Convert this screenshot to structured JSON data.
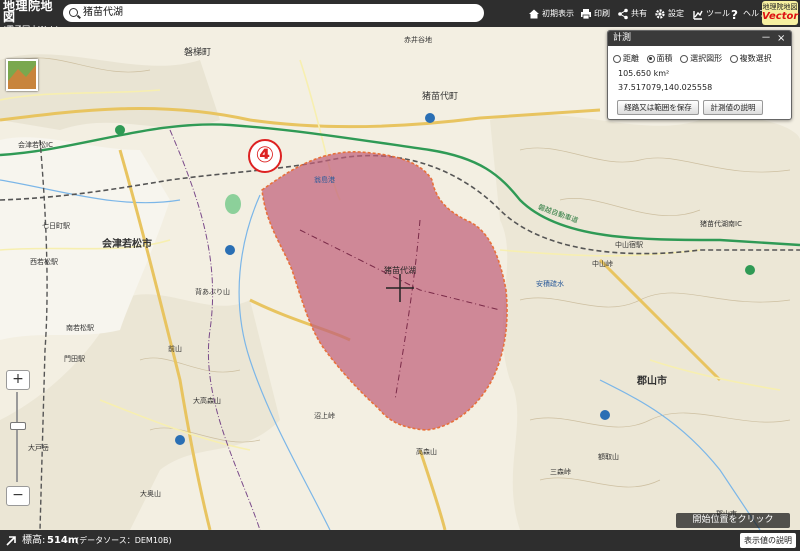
{
  "header": {
    "logo_title": "地理院地図",
    "logo_subtitle": "(電子国土Web)",
    "search_value": "猪苗代湖",
    "initial_view_label": "初期表示",
    "print_label": "印刷",
    "share_label": "共有",
    "settings_label": "設定",
    "tools_label": "ツール",
    "help_label": "ヘルプ",
    "vector_badge_top": "地理院地図",
    "vector_badge_main": "Vector"
  },
  "measure_panel": {
    "title": "計測",
    "minimize": "－",
    "close": "×",
    "options": [
      "距離",
      "面積",
      "選択図形",
      "複数選択"
    ],
    "selected_option": "面積",
    "area_value": "105.650 km²",
    "coordinates": "37.517079,140.025558",
    "save_button": "経路又は範囲を保存",
    "explain_button": "計測値の説明"
  },
  "map": {
    "marker_number": "④",
    "colors": {
      "lake_fill": "#c0607a",
      "lake_edge": "#e8703a",
      "road_green": "#2f9a55",
      "road_major": "#f2e6a0",
      "road_national": "#e0a040"
    },
    "labels": [
      {
        "text": "磐梯町"
      },
      {
        "text": "猪苗代町"
      },
      {
        "text": "猪苗代湖"
      },
      {
        "text": "会津若松市"
      },
      {
        "text": "郡山市"
      },
      {
        "text": "磐越自動車道"
      },
      {
        "text": "翁島港"
      },
      {
        "text": "会津若松IC"
      },
      {
        "text": "七日町駅"
      },
      {
        "text": "西若松駅"
      },
      {
        "text": "南若松駅"
      },
      {
        "text": "門田駅"
      },
      {
        "text": "背あぶり山"
      },
      {
        "text": "大高森山"
      },
      {
        "text": "額取山"
      },
      {
        "text": "猪苗代湖南IC"
      },
      {
        "text": "中山宿駅"
      },
      {
        "text": "高森山"
      },
      {
        "text": "前山"
      },
      {
        "text": "赤井谷地"
      },
      {
        "text": "郡山市"
      },
      {
        "text": "大戸岳"
      },
      {
        "text": "大奥山"
      },
      {
        "text": "中山峠"
      },
      {
        "text": "沼上峠"
      },
      {
        "text": "三森峠"
      },
      {
        "text": "安積疏水"
      }
    ]
  },
  "zoom": {
    "plus": "+",
    "minus": "−"
  },
  "footer": {
    "elevation_label": "標高:",
    "elevation_value": "514m",
    "data_source": "(データソース：DEM10B)",
    "click_hint": "開始位置をクリック",
    "explain_button": "表示値の説明"
  }
}
